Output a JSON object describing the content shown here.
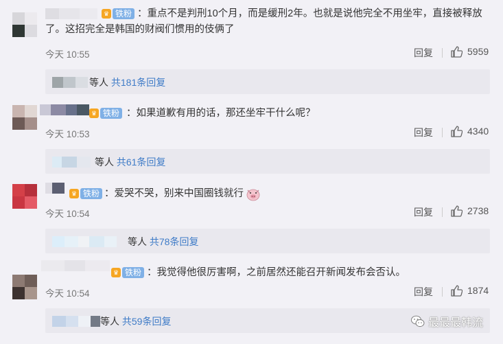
{
  "comments": [
    {
      "badge": "铁粉",
      "text": "：重点不是判刑10个月，而是缓刑2年。也就是说他完全不用坐牢，直接被释放了。这招完全是韩国的财阀们惯用的伎俩了",
      "time": "今天 10:55",
      "reply_label": "回复",
      "likes": "5959",
      "reply_summary": {
        "deng": "等人",
        "link": "共181条回复"
      }
    },
    {
      "badge": "铁粉",
      "text": "：如果道歉有用的话，那还坐牢干什么呢？",
      "time": "今天 10:53",
      "reply_label": "回复",
      "likes": "4340",
      "reply_summary": {
        "deng": "等人",
        "link": "共61条回复"
      }
    },
    {
      "badge": "铁粉",
      "text": "：爱哭不哭，别来中国圈钱就行",
      "time": "今天 10:54",
      "reply_label": "回复",
      "likes": "2738",
      "reply_summary": {
        "deng": "等人",
        "link": "共78条回复"
      }
    },
    {
      "badge": "铁粉",
      "text": "：我觉得他很厉害啊，之前居然还能召开新闻发布会否认。",
      "time": "今天 10:54",
      "reply_label": "回复",
      "likes": "1874",
      "reply_summary": {
        "deng": "等人",
        "link": "共59条回复"
      }
    }
  ],
  "watermark": {
    "text": "最最最韩流"
  },
  "colors": {
    "background": "#f2f1f6",
    "reply_box": "#e9e8ee",
    "link": "#3e7bc7",
    "badge": "#7fb0e6",
    "vip": "#f6a623"
  },
  "icons": [
    "vip-icon",
    "thumbs-up-icon",
    "wechat-icon",
    "pig-emoji-icon"
  ]
}
